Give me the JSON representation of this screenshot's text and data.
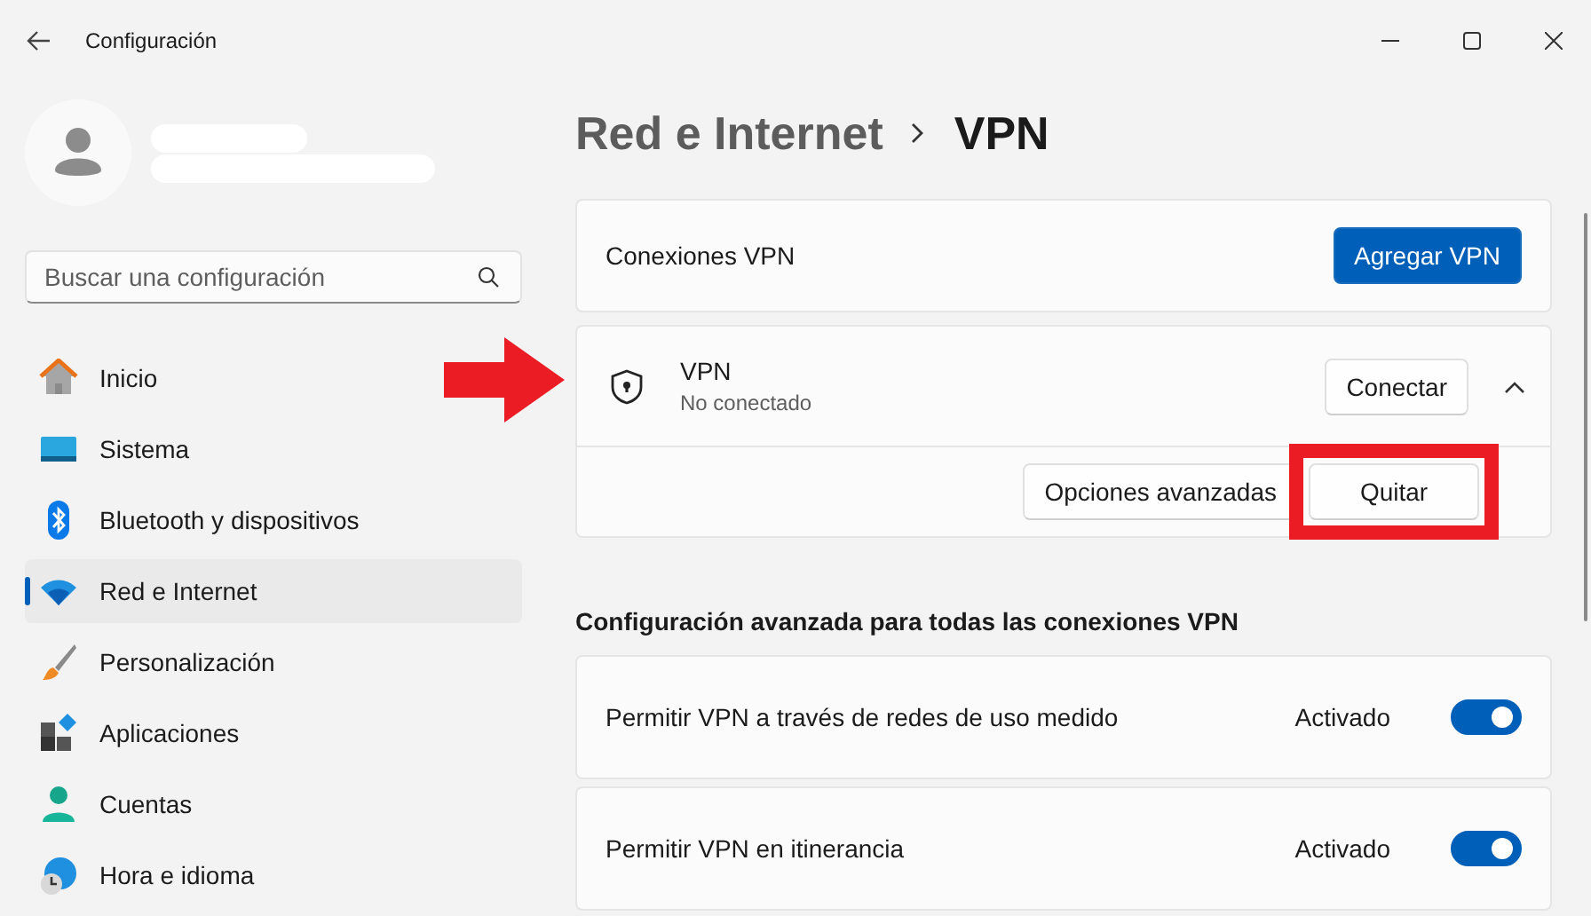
{
  "window": {
    "title": "Configuración"
  },
  "search": {
    "placeholder": "Buscar una configuración"
  },
  "sidebar": {
    "items": [
      {
        "label": "Inicio",
        "kind": "home",
        "selected": false
      },
      {
        "label": "Sistema",
        "kind": "system",
        "selected": false
      },
      {
        "label": "Bluetooth y dispositivos",
        "kind": "bluetooth",
        "selected": false
      },
      {
        "label": "Red e Internet",
        "kind": "network",
        "selected": true
      },
      {
        "label": "Personalización",
        "kind": "brush",
        "selected": false
      },
      {
        "label": "Aplicaciones",
        "kind": "apps",
        "selected": false
      },
      {
        "label": "Cuentas",
        "kind": "person",
        "selected": false
      },
      {
        "label": "Hora e idioma",
        "kind": "time",
        "selected": false
      }
    ]
  },
  "breadcrumb": [
    {
      "label": "Red e Internet",
      "current": false
    },
    {
      "label": "VPN",
      "current": true
    }
  ],
  "vpn_connections": {
    "label": "Conexiones VPN",
    "add_button": "Agregar VPN"
  },
  "vpn": {
    "name": "VPN",
    "status": "No conectado",
    "connect_button": "Conectar",
    "expanded": true,
    "options_button": "Opciones avanzadas",
    "remove_button": "Quitar",
    "pointed_at": true,
    "remove_highlighted": true
  },
  "advanced": {
    "heading": "Configuración avanzada para todas las conexiones VPN",
    "settings": [
      {
        "label": "Permitir VPN a través de redes de uso medido",
        "state_label": "Activado",
        "on": true
      },
      {
        "label": "Permitir VPN en itinerancia",
        "state_label": "Activado",
        "on": true
      }
    ]
  }
}
